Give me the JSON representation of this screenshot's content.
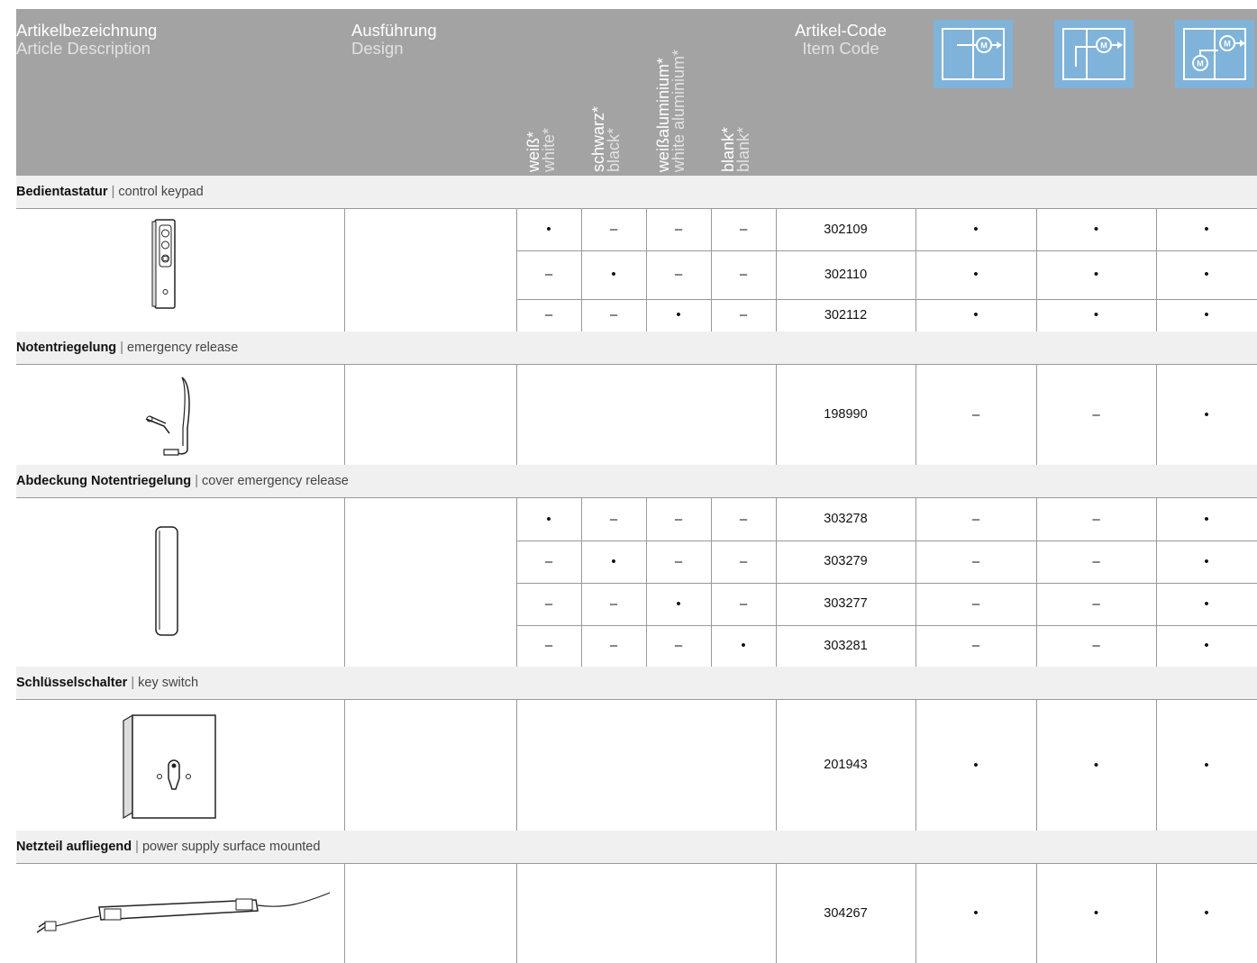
{
  "header": {
    "article_de": "Artikelbezeichnung",
    "article_en": "Article Description",
    "design_de": "Ausführung",
    "design_en": "Design",
    "colors": [
      {
        "de": "weiß*",
        "en": "white*"
      },
      {
        "de": "schwarz*",
        "en": "black*"
      },
      {
        "de": "weißaluminium*",
        "en": "white aluminium*"
      },
      {
        "de": "blank*",
        "en": "blank*"
      }
    ],
    "code_de": "Artikel-Code",
    "code_en": "Item Code",
    "motor_icons": [
      "motor-single-leaf-icon",
      "motor-side-leaf-icon",
      "motor-double-motor-icon"
    ]
  },
  "sections": [
    {
      "title_de": "Bedientastatur",
      "title_en": "control keypad",
      "image_icon": "control-keypad-icon",
      "rows": [
        {
          "colors": [
            "•",
            "–",
            "–",
            "–"
          ],
          "code": "302109",
          "motors": [
            "•",
            "•",
            "•"
          ]
        },
        {
          "colors": [
            "–",
            "•",
            "–",
            "–"
          ],
          "code": "302110",
          "motors": [
            "•",
            "•",
            "•"
          ]
        },
        {
          "colors": [
            "–",
            "–",
            "•",
            "–"
          ],
          "code": "302112",
          "motors": [
            "•",
            "•",
            "•"
          ]
        }
      ]
    },
    {
      "title_de": "Notentriegelung",
      "title_en": "emergency release",
      "image_icon": "emergency-release-handle-icon",
      "rows": [
        {
          "colors": [
            "",
            "",
            "",
            ""
          ],
          "code": "198990",
          "motors": [
            "–",
            "–",
            "•"
          ]
        }
      ]
    },
    {
      "title_de": "Abdeckung Notentriegelung",
      "title_en": "cover emergency release",
      "image_icon": "release-cover-icon",
      "rows": [
        {
          "colors": [
            "•",
            "–",
            "–",
            "–"
          ],
          "code": "303278",
          "motors": [
            "–",
            "–",
            "•"
          ]
        },
        {
          "colors": [
            "–",
            "•",
            "–",
            "–"
          ],
          "code": "303279",
          "motors": [
            "–",
            "–",
            "•"
          ]
        },
        {
          "colors": [
            "–",
            "–",
            "•",
            "–"
          ],
          "code": "303277",
          "motors": [
            "–",
            "–",
            "•"
          ]
        },
        {
          "colors": [
            "–",
            "–",
            "–",
            "•"
          ],
          "code": "303281",
          "motors": [
            "–",
            "–",
            "•"
          ]
        }
      ]
    },
    {
      "title_de": "Schlüsselschalter",
      "title_en": "key switch",
      "image_icon": "key-switch-icon",
      "rows": [
        {
          "colors": [
            "",
            "",
            "",
            ""
          ],
          "code": "201943",
          "motors": [
            "•",
            "•",
            "•"
          ]
        }
      ]
    },
    {
      "title_de": "Netzteil aufliegend",
      "title_en": "power supply surface mounted",
      "image_icon": "power-supply-icon",
      "rows": [
        {
          "colors": [
            "",
            "",
            "",
            ""
          ],
          "code": "304267",
          "motors": [
            "•",
            "•",
            "•"
          ]
        }
      ]
    }
  ],
  "colors": {
    "header_bg": "#a3a3a3",
    "motor_icon_bg": "#7fb3d9",
    "section_bg": "#f0f0f0",
    "grid_line": "#999999"
  }
}
